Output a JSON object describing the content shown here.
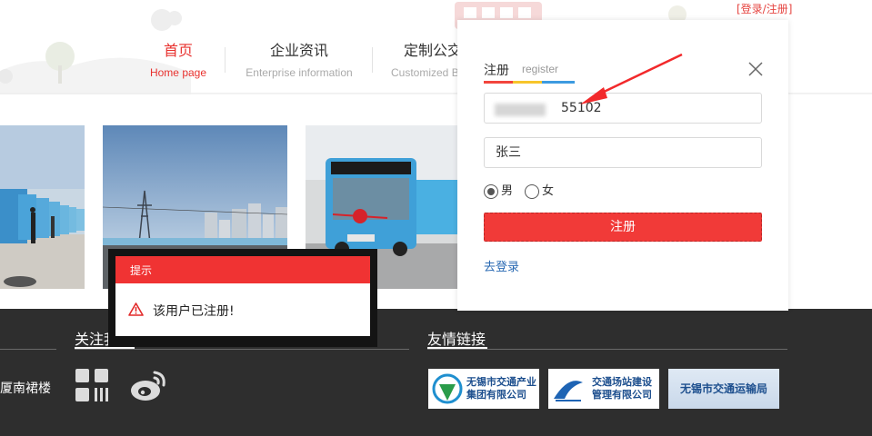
{
  "header": {
    "top_link": "[登录/注册]",
    "nav": [
      {
        "cn": "首页",
        "en": "Home page",
        "active": true
      },
      {
        "cn": "企业资讯",
        "en": "Enterprise information",
        "active": false
      },
      {
        "cn": "定制公交",
        "en": "Customized B",
        "active": false
      }
    ]
  },
  "register": {
    "tab_label": "注册",
    "tab_label_en": "register",
    "phone_value": "55102",
    "name_value": "张三",
    "gender_options": [
      {
        "label": "男",
        "checked": true
      },
      {
        "label": "女",
        "checked": false
      }
    ],
    "submit_label": "注册",
    "login_link": "去登录"
  },
  "toast": {
    "title": "提示",
    "message": "该用户已注册!"
  },
  "footer": {
    "follow_title": "关注我们",
    "links_title": "友情链接",
    "address_fragment": "厦南裙楼",
    "partners": [
      {
        "line1": "无锡市交通产业",
        "line2": "集团有限公司"
      },
      {
        "line1": "交通场站建设",
        "line2": "管理有限公司"
      },
      {
        "line1": "无锡市交通运输局",
        "line2": ""
      }
    ]
  },
  "colors": {
    "accent_red": "#e8312e",
    "button_red": "#f13a38",
    "toast_red": "#f03333",
    "footer_bg": "#2e2e2e",
    "link_blue": "#2a6ab3"
  }
}
